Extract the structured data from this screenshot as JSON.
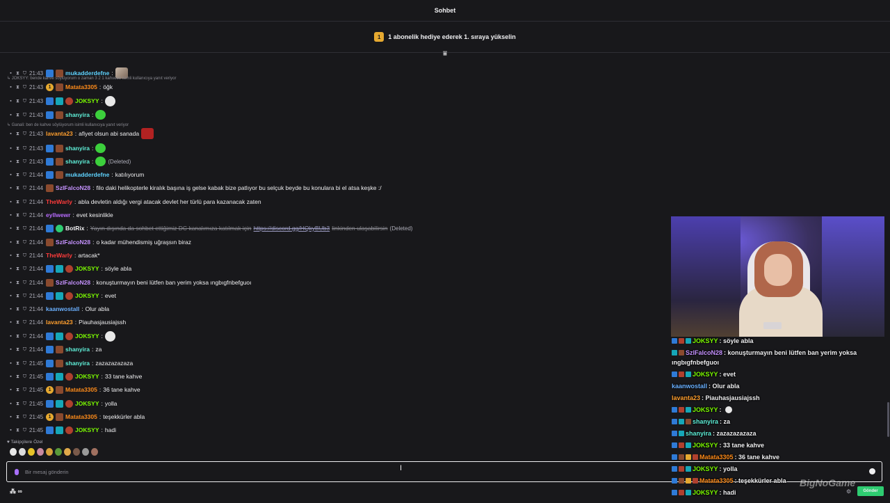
{
  "header": {
    "title": "Sohbet"
  },
  "promo": {
    "badge": "1",
    "text": "1 abonelik hediye ederek 1. sıraya yükselin"
  },
  "messages": [
    {
      "time": "21:43",
      "user": "mukadderdefne",
      "text": "",
      "color": "#5fd3ff"
    },
    {
      "time": "21:43",
      "user": "Matata3305",
      "text": "öğk",
      "color": "#ff8c1a"
    },
    {
      "time": "21:43",
      "user": "JOKSYY",
      "text": "",
      "color": "#7cfc00"
    },
    {
      "time": "21:43",
      "user": "shanyira",
      "text": "",
      "color": "#5fefd8"
    },
    {
      "time": "21:43",
      "user": "lavanta23",
      "text": "afiyet olsun abi sanada",
      "color": "#ff9f2e"
    },
    {
      "time": "21:43",
      "user": "shanyira",
      "text": "",
      "color": "#5fefd8"
    },
    {
      "time": "21:43",
      "user": "shanyira",
      "text": "",
      "color": "#5fefd8",
      "deleted": "(Deleted)"
    },
    {
      "time": "21:44",
      "user": "mukadderdefne",
      "text": "katılıyorum",
      "color": "#5fd3ff"
    },
    {
      "time": "21:44",
      "user": "SzlFalcoN28",
      "text": "filo daki helikopterle kiralık başına iş gelse kabak bize patlıyor bu selçuk beyde bu konulara bi el atsa keşke :/",
      "color": "#c592ff"
    },
    {
      "time": "21:44",
      "user": "TheWarly",
      "text": "abla devletin aldığı vergi atacak devlet her türlü para kazanacak zaten",
      "color": "#ff3b3b"
    },
    {
      "time": "21:44",
      "user": "eyllwewr",
      "text": "evet kesinlikle",
      "color": "#b86bff"
    },
    {
      "time": "21:44",
      "user": "BotRix",
      "text": "Yayın dışında da sohbet ettiğimiz DC kanalımıza katılmak için",
      "link": "https://discord.gg/HQkyBUb3",
      "text2": "linkinden ulaşabilirsin",
      "color": "#efeff1",
      "deleted": "(Deleted)"
    },
    {
      "time": "21:44",
      "user": "SzlFalcoN28",
      "text": "o kadar mühendismiş uğraşsın biraz",
      "color": "#c592ff"
    },
    {
      "time": "21:44",
      "user": "TheWarly",
      "text": "artacak*",
      "color": "#ff3b3b"
    },
    {
      "time": "21:44",
      "user": "JOKSYY",
      "text": "söyle abla",
      "color": "#7cfc00"
    },
    {
      "time": "21:44",
      "user": "SzlFalcoN28",
      "text": "konuşturmayın beni lütfen ban yerim yoksa ıngbıgfnbefguoı",
      "color": "#c592ff"
    },
    {
      "time": "21:44",
      "user": "JOKSYY",
      "text": "evet",
      "color": "#7cfc00"
    },
    {
      "time": "21:44",
      "user": "kaanwostall",
      "text": "Olur abla",
      "color": "#6ab0ff"
    },
    {
      "time": "21:44",
      "user": "lavanta23",
      "text": "Piauhasjausiajssh",
      "color": "#ff9f2e"
    },
    {
      "time": "21:44",
      "user": "JOKSYY",
      "text": "",
      "color": "#7cfc00"
    },
    {
      "time": "21:44",
      "user": "shanyira",
      "text": "za",
      "color": "#5fefd8"
    },
    {
      "time": "21:45",
      "user": "shanyira",
      "text": "zazazazazaza",
      "color": "#5fefd8"
    },
    {
      "time": "21:45",
      "user": "JOKSYY",
      "text": "33 tane kahve",
      "color": "#7cfc00"
    },
    {
      "time": "21:45",
      "user": "Matata3305",
      "text": "36 tane kahve",
      "color": "#ff8c1a"
    },
    {
      "time": "21:45",
      "user": "JOKSYY",
      "text": "yolla",
      "color": "#7cfc00"
    },
    {
      "time": "21:45",
      "user": "Matata3305",
      "text": "teşekkürler abla",
      "color": "#ff8c1a"
    },
    {
      "time": "21:45",
      "user": "JOKSYY",
      "text": "hadi",
      "color": "#7cfc00"
    }
  ],
  "replies": [
    {
      "text": "JOKSYY: bende kahve söylüyorum o zaman 3 2 1 kahveee isimli kullanıcıya yanıt veriyor"
    },
    {
      "text": "Ganali: ben de kahve söylüyorum isimli kullanıcıya yanıt veriyor"
    }
  ],
  "followers_label": "Takipçilere Özel",
  "input": {
    "placeholder": "Bir mesaj gönderin"
  },
  "bottom_left": "∞",
  "send_label": "Gönder",
  "overlay": [
    {
      "user": "JOKSYY",
      "text": ": söyle abla",
      "color": "#7cfc00"
    },
    {
      "user": "SzlFalcoN28",
      "text": ": konuşturmayın beni lütfen ban yerim yoksa",
      "color": "#c592ff"
    },
    {
      "user": "",
      "text": "ıngbıgfnbefguoı",
      "color": "#efeff1"
    },
    {
      "user": "JOKSYY",
      "text": ": evet",
      "color": "#7cfc00"
    },
    {
      "user": "kaanwostall",
      "text": ": Olur abla",
      "color": "#6ab0ff"
    },
    {
      "user": "lavanta23",
      "text": ": Piauhasjausiajssh",
      "color": "#ff9f2e"
    },
    {
      "user": "JOKSYY",
      "text": ":",
      "color": "#7cfc00"
    },
    {
      "user": "shanyira",
      "text": ": za",
      "color": "#5fefd8"
    },
    {
      "user": "shanyira",
      "text": ": zazazazazaza",
      "color": "#5fefd8"
    },
    {
      "user": "JOKSYY",
      "text": ": 33 tane kahve",
      "color": "#7cfc00"
    },
    {
      "user": "Matata3305",
      "text": ": 36 tane kahve",
      "color": "#ff8c1a"
    },
    {
      "user": "JOKSYY",
      "text": ": yolla",
      "color": "#7cfc00"
    },
    {
      "user": "Matata3305",
      "text": ": teşekkürler abla",
      "color": "#ff8c1a"
    },
    {
      "user": "JOKSYY",
      "text": ": hadi",
      "color": "#7cfc00"
    }
  ],
  "watermark": "BigNoGame"
}
